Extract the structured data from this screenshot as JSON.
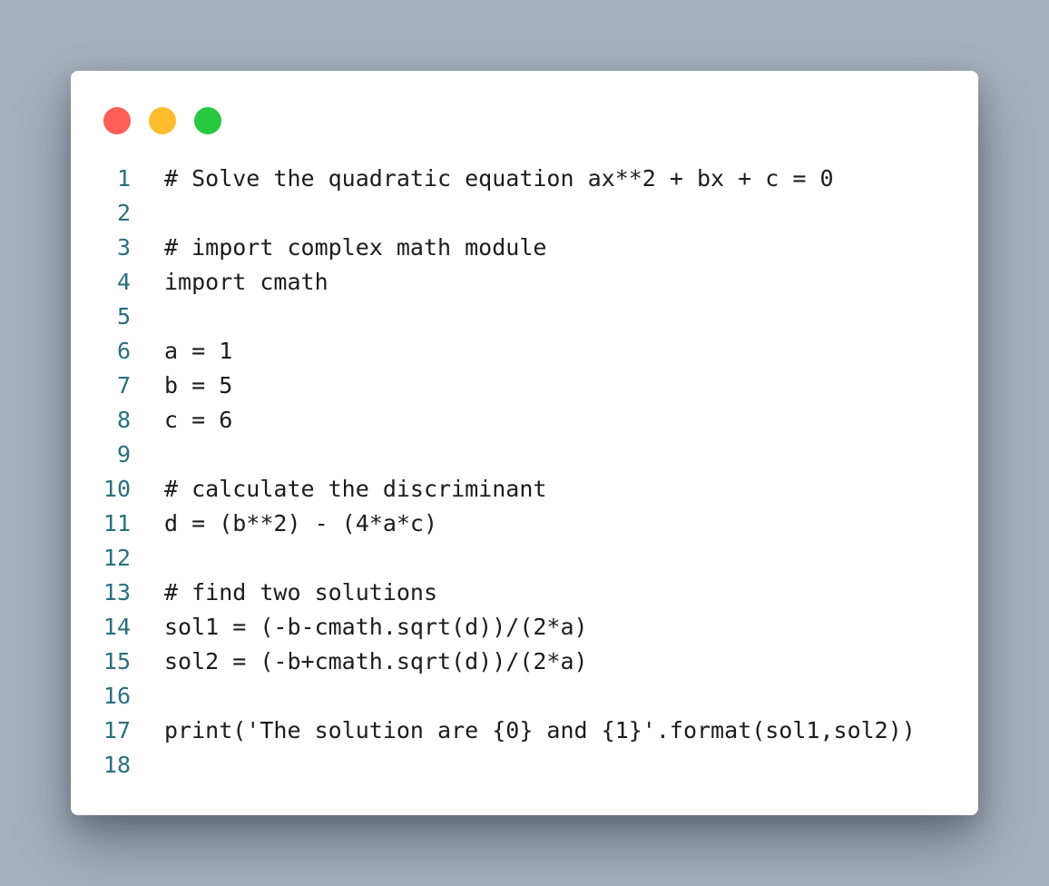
{
  "window": {
    "controls": [
      {
        "name": "close-button",
        "color": "#fe5f57"
      },
      {
        "name": "minimize-button",
        "color": "#febc2e"
      },
      {
        "name": "maximize-button",
        "color": "#28c840"
      }
    ]
  },
  "code": {
    "lines": [
      {
        "number": "1",
        "text": "# Solve the quadratic equation ax**2 + bx + c = 0"
      },
      {
        "number": "2",
        "text": ""
      },
      {
        "number": "3",
        "text": "# import complex math module"
      },
      {
        "number": "4",
        "text": "import cmath"
      },
      {
        "number": "5",
        "text": ""
      },
      {
        "number": "6",
        "text": "a = 1"
      },
      {
        "number": "7",
        "text": "b = 5"
      },
      {
        "number": "8",
        "text": "c = 6"
      },
      {
        "number": "9",
        "text": ""
      },
      {
        "number": "10",
        "text": "# calculate the discriminant"
      },
      {
        "number": "11",
        "text": "d = (b**2) - (4*a*c)"
      },
      {
        "number": "12",
        "text": ""
      },
      {
        "number": "13",
        "text": "# find two solutions"
      },
      {
        "number": "14",
        "text": "sol1 = (-b-cmath.sqrt(d))/(2*a)"
      },
      {
        "number": "15",
        "text": "sol2 = (-b+cmath.sqrt(d))/(2*a)"
      },
      {
        "number": "16",
        "text": ""
      },
      {
        "number": "17",
        "text": "print('The solution are {0} and {1}'.format(sol1,sol2))"
      },
      {
        "number": "18",
        "text": ""
      }
    ]
  }
}
